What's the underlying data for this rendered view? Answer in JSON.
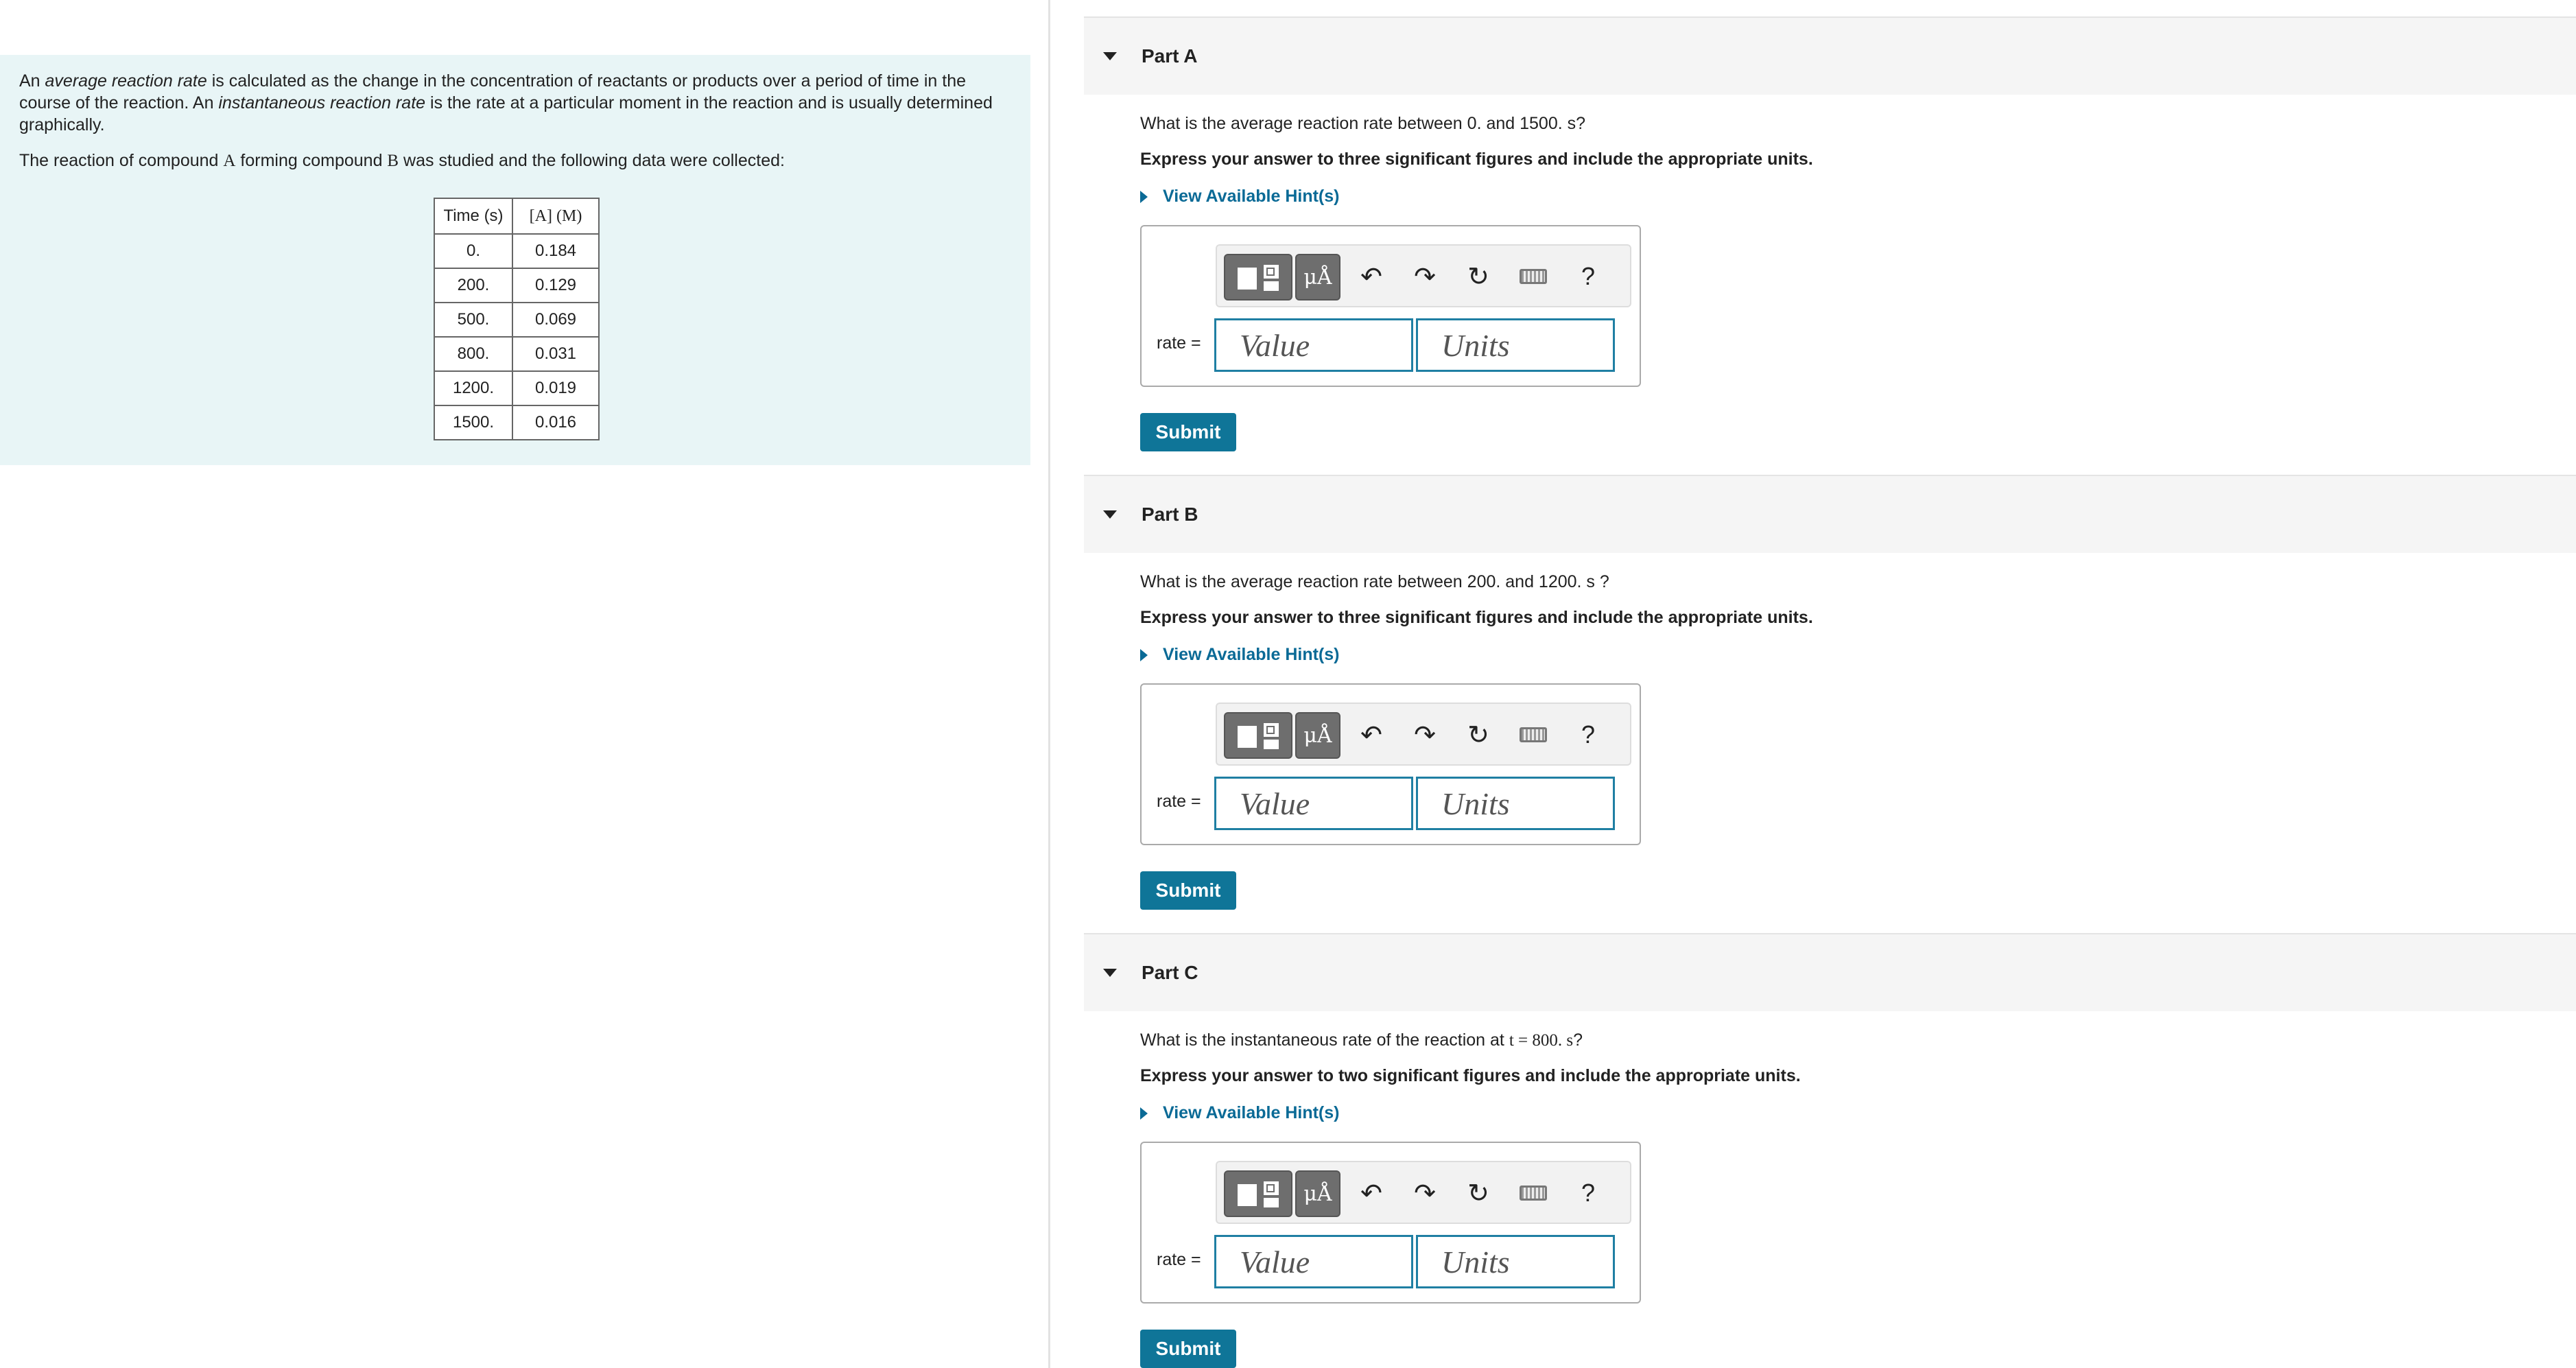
{
  "intro": {
    "p1_pre": "An ",
    "p1_term1": "average reaction rate",
    "p1_mid": " is calculated as the change in the concentration of reactants or products over a period of time in the course of the reaction. An ",
    "p1_term2": "instantaneous reaction rate",
    "p1_post": " is the rate at a particular moment in the reaction and is usually determined graphically.",
    "p2_pre": "The reaction of compound ",
    "p2_A": "A",
    "p2_mid": " forming compound ",
    "p2_B": "B",
    "p2_post": " was studied and the following data were collected:"
  },
  "table": {
    "headers": [
      "Time (s)",
      "[A] (M)"
    ],
    "rows": [
      [
        "0.",
        "0.184"
      ],
      [
        "200.",
        "0.129"
      ],
      [
        "500.",
        "0.069"
      ],
      [
        "800.",
        "0.031"
      ],
      [
        "1200.",
        "0.019"
      ],
      [
        "1500.",
        "0.016"
      ]
    ]
  },
  "parts": [
    {
      "title": "Part A",
      "question": "What is the average reaction rate between 0. and 1500. s?",
      "instruction": "Express your answer to three significant figures and include the appropriate units.",
      "hint": "View Available Hint(s)",
      "rate_label": "rate =",
      "value_placeholder": "Value",
      "units_placeholder": "Units",
      "submit": "Submit"
    },
    {
      "title": "Part B",
      "question": "What is the average reaction rate between 200. and 1200. s ?",
      "instruction": "Express your answer to three significant figures and include the appropriate units.",
      "hint": "View Available Hint(s)",
      "rate_label": "rate =",
      "value_placeholder": "Value",
      "units_placeholder": "Units",
      "submit": "Submit"
    },
    {
      "title": "Part C",
      "question_pre": "What is the instantaneous rate of the reaction at ",
      "question_math": "t = 800. s",
      "question_post": "?",
      "instruction": "Express your answer to two significant figures and include the appropriate units.",
      "hint": "View Available Hint(s)",
      "rate_label": "rate =",
      "value_placeholder": "Value",
      "units_placeholder": "Units",
      "submit": "Submit"
    }
  ],
  "toolbar": {
    "units_symbol": "μÅ",
    "undo_icon": "↶",
    "redo_icon": "↷",
    "reset_icon": "↻",
    "help_label": "?"
  }
}
